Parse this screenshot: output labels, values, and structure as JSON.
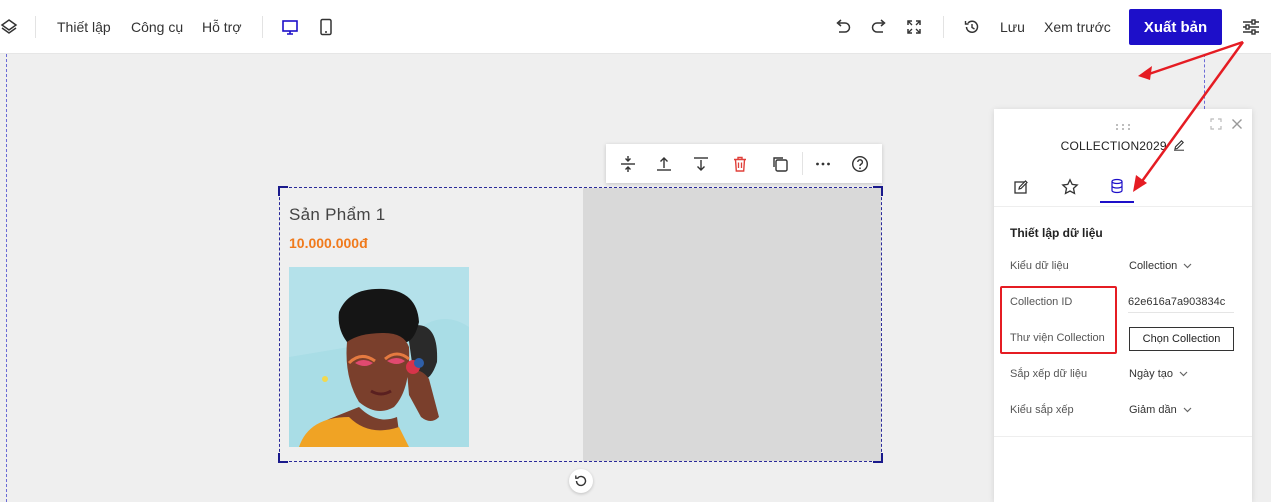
{
  "toolbar": {
    "menu": [
      "Thiết lập",
      "Công cụ",
      "Hỗ trợ"
    ],
    "save_label": "Lưu",
    "preview_label": "Xem trước",
    "publish_label": "Xuất bản"
  },
  "product": {
    "name": "Sản Phẩm 1",
    "price": "10.000.000đ"
  },
  "panel": {
    "title": "COLLECTION2029",
    "section_title": "Thiết lập dữ liệu",
    "data_type_label": "Kiểu dữ liệu",
    "data_type_value": "Collection",
    "collection_id_label": "Collection ID",
    "collection_id_value": "62e616a7a903834c",
    "library_label": "Thư viện Collection",
    "choose_button": "Chọn Collection",
    "sort_label": "Sắp xếp dữ liệu",
    "sort_value": "Ngày tạo",
    "order_label": "Kiểu sắp xếp",
    "order_value": "Giảm dần"
  },
  "colors": {
    "accent": "#1d0fc9",
    "price": "#f07a1c",
    "annotation": "#e51c23"
  }
}
